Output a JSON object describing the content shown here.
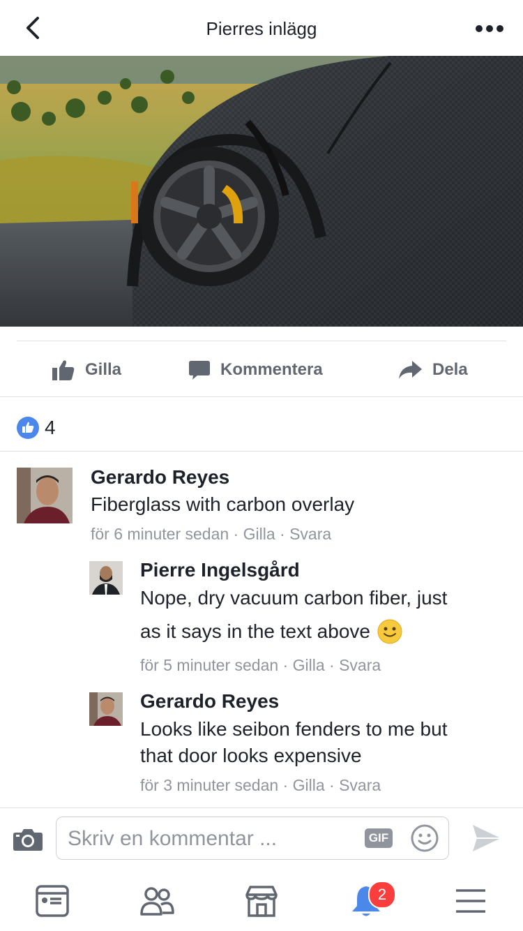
{
  "header": {
    "title": "Pierres inlägg",
    "back_icon": "chevron-left-icon",
    "more_icon": "more-horizontal-icon"
  },
  "actions": {
    "like_label": "Gilla",
    "comment_label": "Kommentera",
    "share_label": "Dela"
  },
  "reactions": {
    "count": "4"
  },
  "comments": [
    {
      "author": "Gerardo Reyes",
      "text": "Fiberglass with carbon overlay",
      "time": "för 6 minuter sedan",
      "like": "Gilla",
      "reply": "Svara"
    },
    {
      "author": "Pierre Ingelsgård",
      "text_line1": "Nope, dry vacuum carbon fiber, just",
      "text_line2": "as it says in the text above",
      "emoji": "🙂",
      "time": "för 5 minuter sedan",
      "like": "Gilla",
      "reply": "Svara"
    },
    {
      "author": "Gerardo Reyes",
      "text_line1": "Looks like seibon fenders to me but",
      "text_line2": "that door looks expensive",
      "time": "för 3 minuter sedan",
      "like": "Gilla",
      "reply": "Svara"
    }
  ],
  "composer": {
    "placeholder": "Skriv en kommentar ...",
    "gif_label": "GIF"
  },
  "tabbar": {
    "notification_badge": "2"
  },
  "colors": {
    "accent": "#4b88ea",
    "muted": "#90949c",
    "action_gray": "#606770",
    "badge_red": "#fa3e3e"
  }
}
